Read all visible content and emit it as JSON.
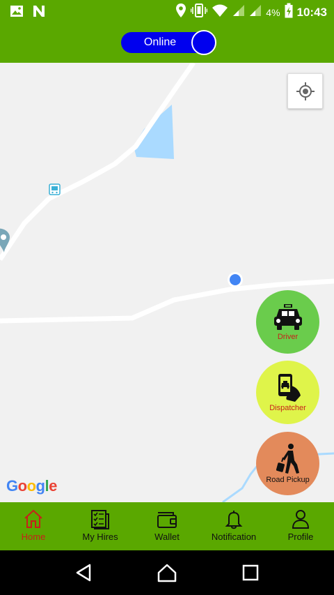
{
  "status_bar": {
    "time": "10:43",
    "battery_percent": "4%",
    "left_icons": [
      "image-icon",
      "n-app-icon"
    ],
    "right_icons": [
      "location-icon",
      "vibrate-icon",
      "wifi-icon",
      "signal-icon",
      "signal-icon",
      "battery-charging-icon"
    ]
  },
  "online_toggle": {
    "label": "Online",
    "state": "on"
  },
  "map": {
    "attribution": [
      "G",
      "o",
      "o",
      "g",
      "l",
      "e"
    ]
  },
  "fabs": [
    {
      "label": "Driver",
      "icon": "taxi-icon"
    },
    {
      "label": "Dispatcher",
      "icon": "phone-driver-icon"
    },
    {
      "label": "Road Pickup",
      "icon": "walking-luggage-icon"
    }
  ],
  "bottom_nav": [
    {
      "label": "Home",
      "icon": "home-icon",
      "active": true
    },
    {
      "label": "My Hires",
      "icon": "hires-icon",
      "active": false
    },
    {
      "label": "Wallet",
      "icon": "wallet-icon",
      "active": false
    },
    {
      "label": "Notification",
      "icon": "bell-icon",
      "active": false
    },
    {
      "label": "Profile",
      "icon": "profile-icon",
      "active": false
    }
  ],
  "colors": {
    "app_green": "#5aa800",
    "toggle_blue": "#0000ee",
    "driver_fab": "#6acc4c",
    "dispatcher_fab": "#dff44a",
    "road_pickup_fab": "#e38a5b",
    "active_nav": "#c8201a"
  }
}
